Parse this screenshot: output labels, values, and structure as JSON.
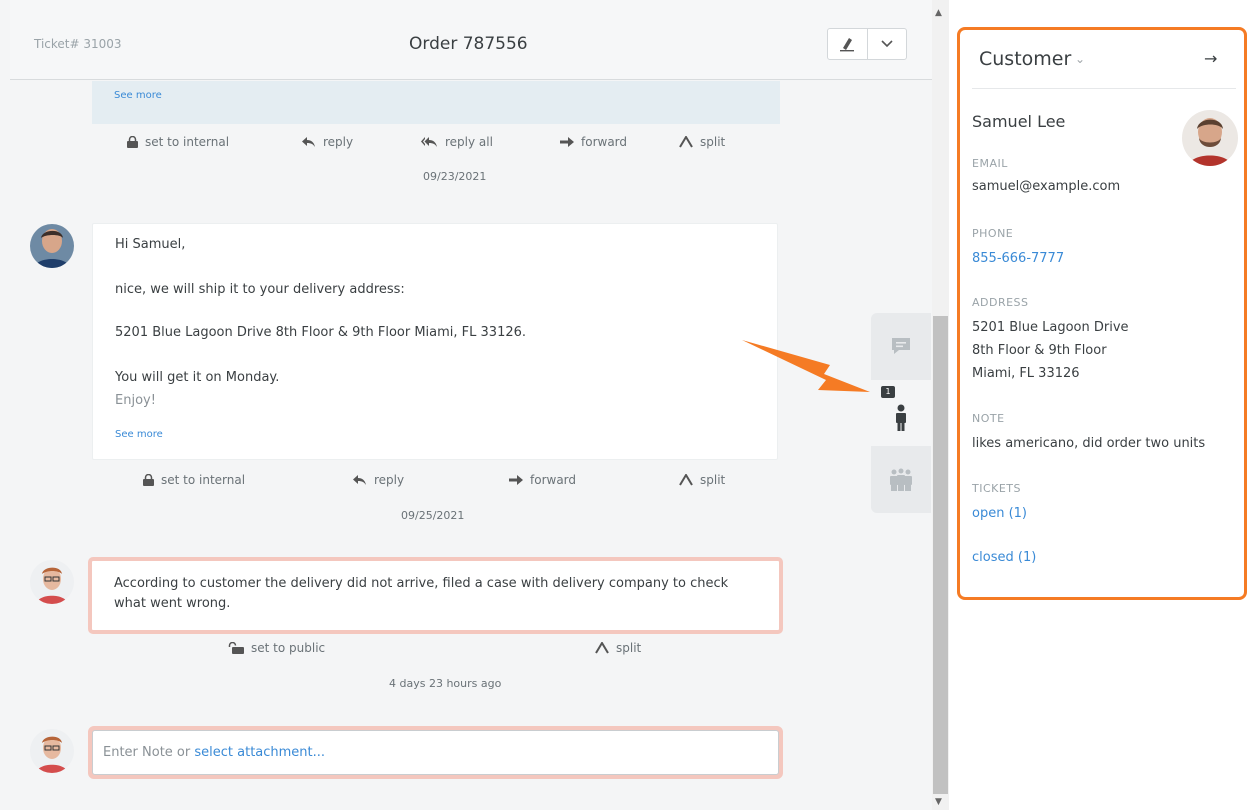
{
  "ticket": {
    "number": "Ticket# 31003",
    "title": "Order 787556"
  },
  "article_prev": {
    "see_more": "See more",
    "actions": {
      "internal": "set to internal",
      "reply": "reply",
      "reply_all": "reply all",
      "forward": "forward",
      "split": "split"
    },
    "date": "09/23/2021"
  },
  "article_main": {
    "lines": {
      "greeting": "Hi Samuel,",
      "ship": "nice, we will ship it to your delivery address:",
      "address": "5201 Blue Lagoon Drive 8th Floor & 9th Floor Miami, FL 33126.",
      "monday": "You will get it on Monday.",
      "enjoy": "Enjoy!"
    },
    "see_more": "See more",
    "actions": {
      "internal": "set to internal",
      "reply": "reply",
      "forward": "forward",
      "split": "split"
    },
    "date": "09/25/2021"
  },
  "note": {
    "text": "According to customer the delivery did not arrive, filed a case with delivery company to check what went wrong.",
    "actions": {
      "public": "set to public",
      "split": "split"
    },
    "time": "4 days 23 hours ago"
  },
  "compose": {
    "placeholder": "Enter Note or ",
    "attachment_link": "select attachment..."
  },
  "side_tabs": {
    "customer_badge": "1"
  },
  "customer": {
    "title": "Customer",
    "name": "Samuel Lee",
    "email_label": "EMAIL",
    "email": "samuel@example.com",
    "phone_label": "PHONE",
    "phone": "855-666-7777",
    "address_label": "ADDRESS",
    "address_line1": "5201 Blue Lagoon Drive",
    "address_line2": "8th Floor & 9th Floor",
    "address_line3": "Miami, FL 33126",
    "note_label": "NOTE",
    "note": "likes americano, did order two units",
    "tickets_label": "TICKETS",
    "tickets_open": "open (1)",
    "tickets_closed": "closed (1)"
  },
  "colors": {
    "accent": "#f57b24",
    "link": "#3a8ad6",
    "note_border": "#f4c7be"
  }
}
